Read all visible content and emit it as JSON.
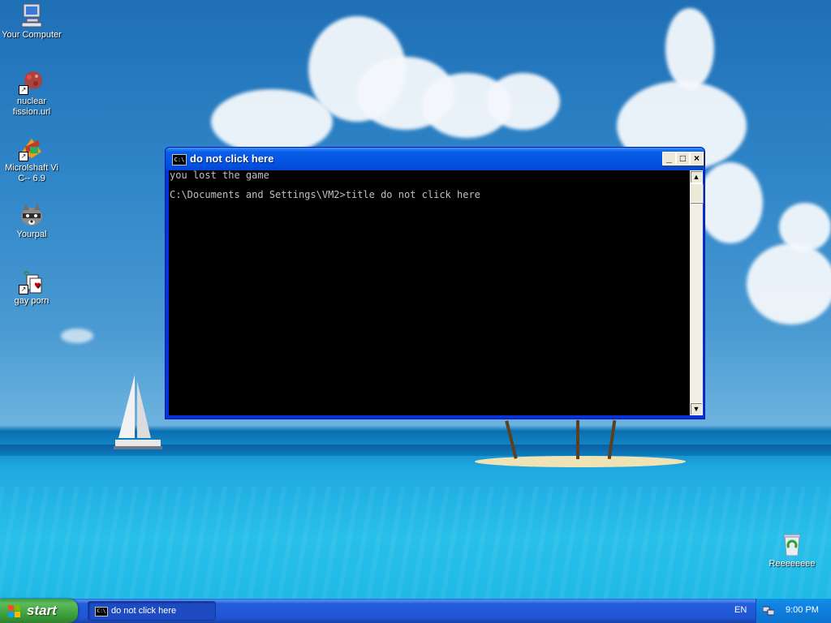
{
  "desktop": {
    "icons": [
      {
        "label": "Your Computer",
        "icon": "my-computer-icon"
      },
      {
        "label": "nuclear fission.url",
        "icon": "internet-shortcut-icon"
      },
      {
        "label": "Microlshaft Vi C-- 6.9",
        "icon": "visual-cpp-icon"
      },
      {
        "label": "Yourpal",
        "icon": "raccoon-icon"
      },
      {
        "label": "gay porn",
        "icon": "cards-game-icon"
      }
    ],
    "recycle_bin": {
      "label": "Reeeeeeee",
      "icon": "recycle-bin-icon"
    }
  },
  "window": {
    "title": "do not click here",
    "title_icon": "C:\\",
    "buttons": {
      "minimize": "_",
      "maximize": "□",
      "close": "×"
    },
    "console_lines": [
      "you lost the game",
      "",
      "C:\\Documents and Settings\\VM2>title do not click here"
    ],
    "scroll_up": "▲",
    "scroll_down": "▼"
  },
  "taskbar": {
    "start_label": "start",
    "tasks": [
      {
        "label": "do not click here",
        "icon": "C:\\"
      }
    ],
    "language": "EN",
    "clock": "9:00 PM"
  },
  "colors": {
    "titlebar": "#0553e4",
    "taskbar": "#245edb",
    "start_button": "#3a9c3a",
    "console_bg": "#000000",
    "console_fg": "#c0c0c0"
  }
}
